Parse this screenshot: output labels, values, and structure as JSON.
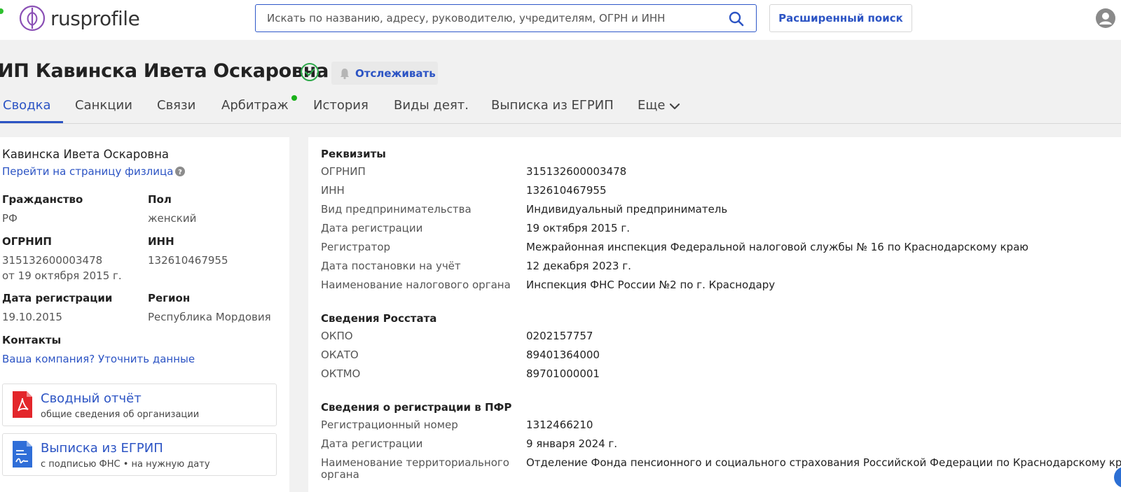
{
  "header": {
    "logo_text": "rusprofile",
    "search_placeholder": "Искать по названию, адресу, руководителю, учредителям, ОГРН и ИНН",
    "advanced_search_label": "Расширенный поиск",
    "accent_color": "#2c54c4"
  },
  "page": {
    "title": "ИП Кавинска Ивета Оскаровна",
    "track_label": "Отслеживать"
  },
  "tabs": [
    {
      "label": "Сводка"
    },
    {
      "label": "Санкции"
    },
    {
      "label": "Связи"
    },
    {
      "label": "Арбитраж"
    },
    {
      "label": "История"
    },
    {
      "label": "Виды деят."
    },
    {
      "label": "Выписка из ЕГРИП"
    },
    {
      "label": "Еще"
    }
  ],
  "left": {
    "name": "Кавинска Ивета Оскаровна",
    "person_link": "Перейти на страницу физлица",
    "citizenship_label": "Гражданство",
    "citizenship_value": "РФ",
    "gender_label": "Пол",
    "gender_value": "женский",
    "ogrnip_label": "ОГРНИП",
    "ogrnip_value": "315132600003478",
    "ogrnip_date": "от 19 октября 2015 г.",
    "inn_label": "ИНН",
    "inn_value": "132610467955",
    "reg_date_label": "Дата регистрации",
    "reg_date_value": "19.10.2015",
    "region_label": "Регион",
    "region_value": "Республика Мордовия",
    "contacts_label": "Контакты",
    "contacts_link": "Ваша компания? Уточнить данные",
    "doc1_title": "Сводный отчёт",
    "doc1_sub": "общие сведения об организации",
    "doc2_title": "Выписка из ЕГРИП",
    "doc2_sub": "с подписью ФНС • на нужную дату"
  },
  "requisites": {
    "heading": "Реквизиты",
    "rows": [
      {
        "label": "ОГРНИП",
        "value": "315132600003478"
      },
      {
        "label": "ИНН",
        "value": "132610467955"
      },
      {
        "label": "Вид предпринимательства",
        "value": "Индивидуальный предприниматель"
      },
      {
        "label": "Дата регистрации",
        "value": "19 октября 2015 г."
      },
      {
        "label": "Регистратор",
        "value": "Межрайонная инспекция Федеральной налоговой службы № 16 по Краснодарскому краю"
      },
      {
        "label": "Дата постановки на учёт",
        "value": "12 декабря 2023 г."
      },
      {
        "label": "Наименование налогового органа",
        "value": "Инспекция ФНС России №2 по г. Краснодару"
      }
    ]
  },
  "rosstat": {
    "heading": "Сведения Росстата",
    "rows": [
      {
        "label": "ОКПО",
        "value": "0202157757"
      },
      {
        "label": "ОКАТО",
        "value": "89401364000"
      },
      {
        "label": "ОКТМО",
        "value": "89701000001"
      }
    ]
  },
  "pfr": {
    "heading": "Сведения о регистрации в ПФР",
    "rows": [
      {
        "label": "Регистрационный номер",
        "value": "1312466210"
      },
      {
        "label": "Дата регистрации",
        "value": "9 января 2024 г."
      },
      {
        "label_line1": "Наименование территориального",
        "label_line2": "органа",
        "value": "Отделение Фонда пенсионного и социального страхования Российской Федерации по Краснодарскому краю"
      }
    ]
  }
}
